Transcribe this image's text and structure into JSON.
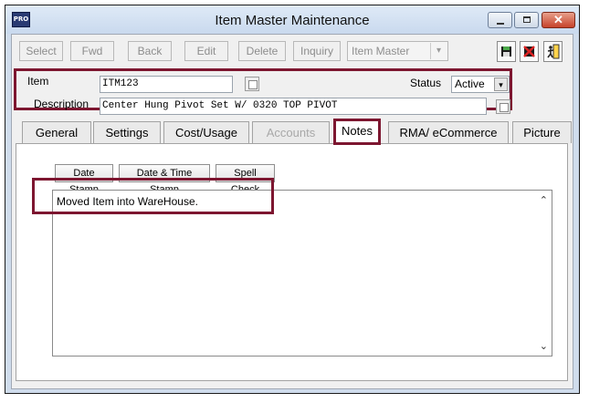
{
  "window": {
    "app_icon": "PRO",
    "title": "Item Master Maintenance"
  },
  "toolbar": {
    "select": "Select",
    "fwd": "Fwd",
    "back": "Back",
    "edit": "Edit",
    "delete": "Delete",
    "inquiry": "Inquiry",
    "view_combo": "Item Master"
  },
  "header": {
    "item_label": "Item",
    "item_value": "ITM123",
    "status_label": "Status",
    "status_value": "Active",
    "description_label": "Description",
    "description_value": "Center Hung Pivot Set W/ 0320 TOP PIVOT"
  },
  "tabs": [
    {
      "label": "General"
    },
    {
      "label": "Settings"
    },
    {
      "label": "Cost/Usage"
    },
    {
      "label": "Accounts"
    },
    {
      "label": "Notes"
    },
    {
      "label": "RMA/ eCommerce"
    },
    {
      "label": "Picture"
    }
  ],
  "notes": {
    "date_stamp": "Date Stamp",
    "date_time_stamp": "Date & Time Stamp",
    "spell_check": "Spell Check",
    "text": "Moved Item into WareHouse."
  },
  "icons": {
    "save": "save-icon",
    "cancel": "cancel-icon",
    "exit": "exit-icon"
  },
  "colors": {
    "highlight": "#7d1630",
    "titlebar": "#cfdcec"
  }
}
